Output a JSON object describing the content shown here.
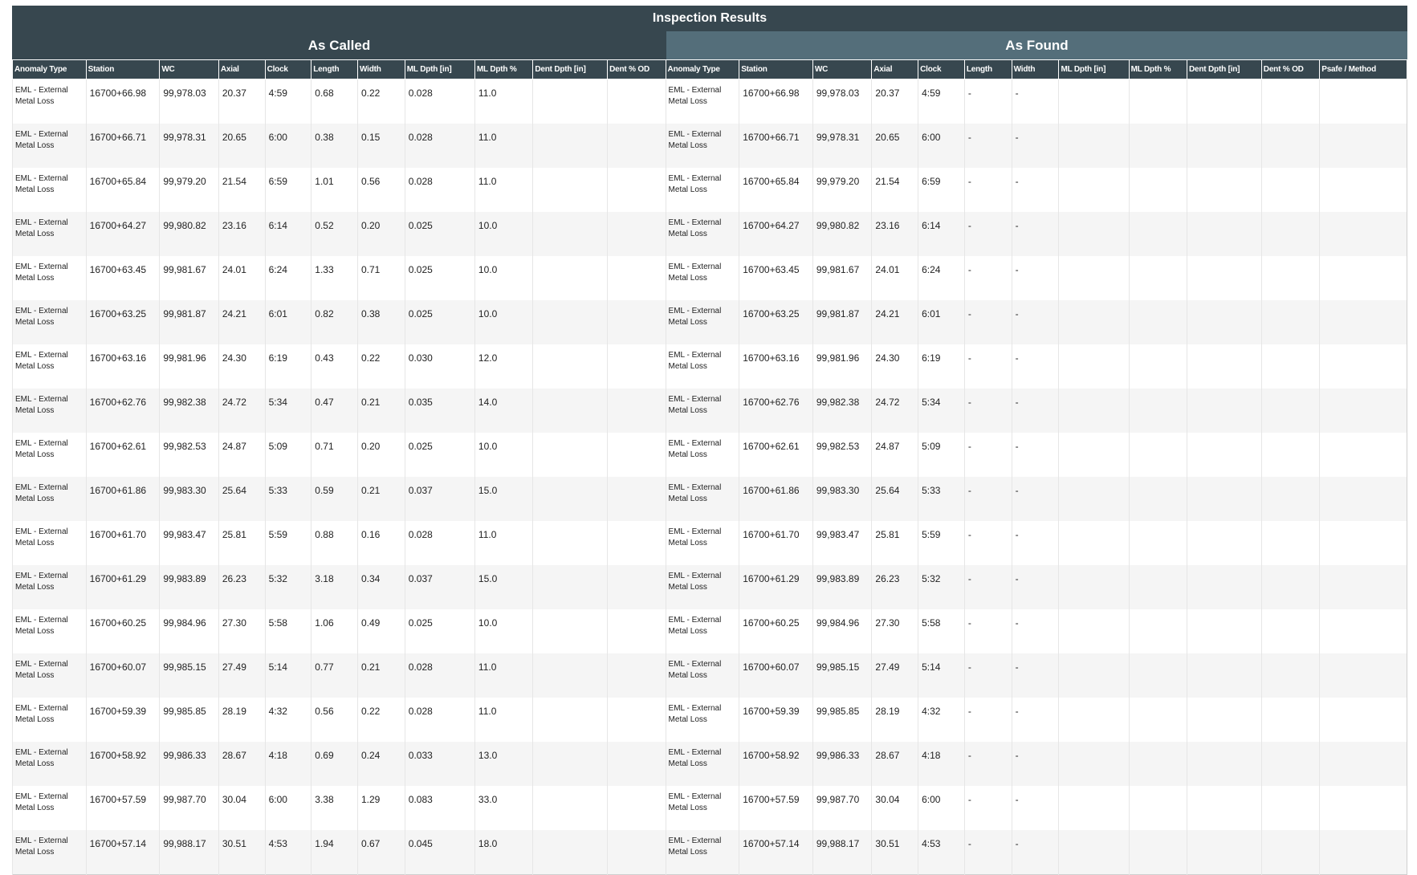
{
  "title": "Inspection Results",
  "sections": {
    "called": "As Called",
    "found": "As Found"
  },
  "columns_called": [
    "Anomaly Type",
    "Station",
    "WC",
    "Axial",
    "Clock",
    "Length",
    "Width",
    "ML Dpth [in]",
    "ML Dpth %",
    "Dent Dpth [in]",
    "Dent % OD"
  ],
  "columns_found": [
    "Anomaly Type",
    "Station",
    "WC",
    "Axial",
    "Clock",
    "Length",
    "Width",
    "ML Dpth [in]",
    "ML Dpth %",
    "Dent Dpth [in]",
    "Dent % OD",
    "Psafe / Method"
  ],
  "rows": [
    {
      "type_line1": "EML - External",
      "type_line2": "Metal Loss",
      "station": "16700+66.98",
      "wc": "99,978.03",
      "axial": "20.37",
      "clock": "4:59",
      "length": "0.68",
      "width": "0.22",
      "ml_dpth_in": "0.028",
      "ml_dpth_pct": "11.0",
      "found_length": "-",
      "found_width": "-"
    },
    {
      "type_line1": "EML - External",
      "type_line2": "Metal Loss",
      "station": "16700+66.71",
      "wc": "99,978.31",
      "axial": "20.65",
      "clock": "6:00",
      "length": "0.38",
      "width": "0.15",
      "ml_dpth_in": "0.028",
      "ml_dpth_pct": "11.0",
      "found_length": "-",
      "found_width": "-"
    },
    {
      "type_line1": "EML - External",
      "type_line2": "Metal Loss",
      "station": "16700+65.84",
      "wc": "99,979.20",
      "axial": "21.54",
      "clock": "6:59",
      "length": "1.01",
      "width": "0.56",
      "ml_dpth_in": "0.028",
      "ml_dpth_pct": "11.0",
      "found_length": "-",
      "found_width": "-"
    },
    {
      "type_line1": "EML - External",
      "type_line2": "Metal Loss",
      "station": "16700+64.27",
      "wc": "99,980.82",
      "axial": "23.16",
      "clock": "6:14",
      "length": "0.52",
      "width": "0.20",
      "ml_dpth_in": "0.025",
      "ml_dpth_pct": "10.0",
      "found_length": "-",
      "found_width": "-"
    },
    {
      "type_line1": "EML - External",
      "type_line2": "Metal Loss",
      "station": "16700+63.45",
      "wc": "99,981.67",
      "axial": "24.01",
      "clock": "6:24",
      "length": "1.33",
      "width": "0.71",
      "ml_dpth_in": "0.025",
      "ml_dpth_pct": "10.0",
      "found_length": "-",
      "found_width": "-"
    },
    {
      "type_line1": "EML - External",
      "type_line2": "Metal Loss",
      "station": "16700+63.25",
      "wc": "99,981.87",
      "axial": "24.21",
      "clock": "6:01",
      "length": "0.82",
      "width": "0.38",
      "ml_dpth_in": "0.025",
      "ml_dpth_pct": "10.0",
      "found_length": "-",
      "found_width": "-"
    },
    {
      "type_line1": "EML - External",
      "type_line2": "Metal Loss",
      "station": "16700+63.16",
      "wc": "99,981.96",
      "axial": "24.30",
      "clock": "6:19",
      "length": "0.43",
      "width": "0.22",
      "ml_dpth_in": "0.030",
      "ml_dpth_pct": "12.0",
      "found_length": "-",
      "found_width": "-"
    },
    {
      "type_line1": "EML - External",
      "type_line2": "Metal Loss",
      "station": "16700+62.76",
      "wc": "99,982.38",
      "axial": "24.72",
      "clock": "5:34",
      "length": "0.47",
      "width": "0.21",
      "ml_dpth_in": "0.035",
      "ml_dpth_pct": "14.0",
      "found_length": "-",
      "found_width": "-"
    },
    {
      "type_line1": "EML - External",
      "type_line2": "Metal Loss",
      "station": "16700+62.61",
      "wc": "99,982.53",
      "axial": "24.87",
      "clock": "5:09",
      "length": "0.71",
      "width": "0.20",
      "ml_dpth_in": "0.025",
      "ml_dpth_pct": "10.0",
      "found_length": "-",
      "found_width": "-"
    },
    {
      "type_line1": "EML - External",
      "type_line2": "Metal Loss",
      "station": "16700+61.86",
      "wc": "99,983.30",
      "axial": "25.64",
      "clock": "5:33",
      "length": "0.59",
      "width": "0.21",
      "ml_dpth_in": "0.037",
      "ml_dpth_pct": "15.0",
      "found_length": "-",
      "found_width": "-"
    },
    {
      "type_line1": "EML - External",
      "type_line2": "Metal Loss",
      "station": "16700+61.70",
      "wc": "99,983.47",
      "axial": "25.81",
      "clock": "5:59",
      "length": "0.88",
      "width": "0.16",
      "ml_dpth_in": "0.028",
      "ml_dpth_pct": "11.0",
      "found_length": "-",
      "found_width": "-"
    },
    {
      "type_line1": "EML - External",
      "type_line2": "Metal Loss",
      "station": "16700+61.29",
      "wc": "99,983.89",
      "axial": "26.23",
      "clock": "5:32",
      "length": "3.18",
      "width": "0.34",
      "ml_dpth_in": "0.037",
      "ml_dpth_pct": "15.0",
      "found_length": "-",
      "found_width": "-"
    },
    {
      "type_line1": "EML - External",
      "type_line2": "Metal Loss",
      "station": "16700+60.25",
      "wc": "99,984.96",
      "axial": "27.30",
      "clock": "5:58",
      "length": "1.06",
      "width": "0.49",
      "ml_dpth_in": "0.025",
      "ml_dpth_pct": "10.0",
      "found_length": "-",
      "found_width": "-"
    },
    {
      "type_line1": "EML - External",
      "type_line2": "Metal Loss",
      "station": "16700+60.07",
      "wc": "99,985.15",
      "axial": "27.49",
      "clock": "5:14",
      "length": "0.77",
      "width": "0.21",
      "ml_dpth_in": "0.028",
      "ml_dpth_pct": "11.0",
      "found_length": "-",
      "found_width": "-"
    },
    {
      "type_line1": "EML - External",
      "type_line2": "Metal Loss",
      "station": "16700+59.39",
      "wc": "99,985.85",
      "axial": "28.19",
      "clock": "4:32",
      "length": "0.56",
      "width": "0.22",
      "ml_dpth_in": "0.028",
      "ml_dpth_pct": "11.0",
      "found_length": "-",
      "found_width": "-"
    },
    {
      "type_line1": "EML - External",
      "type_line2": "Metal Loss",
      "station": "16700+58.92",
      "wc": "99,986.33",
      "axial": "28.67",
      "clock": "4:18",
      "length": "0.69",
      "width": "0.24",
      "ml_dpth_in": "0.033",
      "ml_dpth_pct": "13.0",
      "found_length": "-",
      "found_width": "-"
    },
    {
      "type_line1": "EML - External",
      "type_line2": "Metal Loss",
      "station": "16700+57.59",
      "wc": "99,987.70",
      "axial": "30.04",
      "clock": "6:00",
      "length": "3.38",
      "width": "1.29",
      "ml_dpth_in": "0.083",
      "ml_dpth_pct": "33.0",
      "found_length": "-",
      "found_width": "-"
    },
    {
      "type_line1": "EML - External",
      "type_line2": "Metal Loss",
      "station": "16700+57.14",
      "wc": "99,988.17",
      "axial": "30.51",
      "clock": "4:53",
      "length": "1.94",
      "width": "0.67",
      "ml_dpth_in": "0.045",
      "ml_dpth_pct": "18.0",
      "found_length": "-",
      "found_width": "-"
    }
  ],
  "colors": {
    "header_dark": "#37474f",
    "header_light": "#546e7a",
    "row_alt": "#f5f5f5"
  }
}
